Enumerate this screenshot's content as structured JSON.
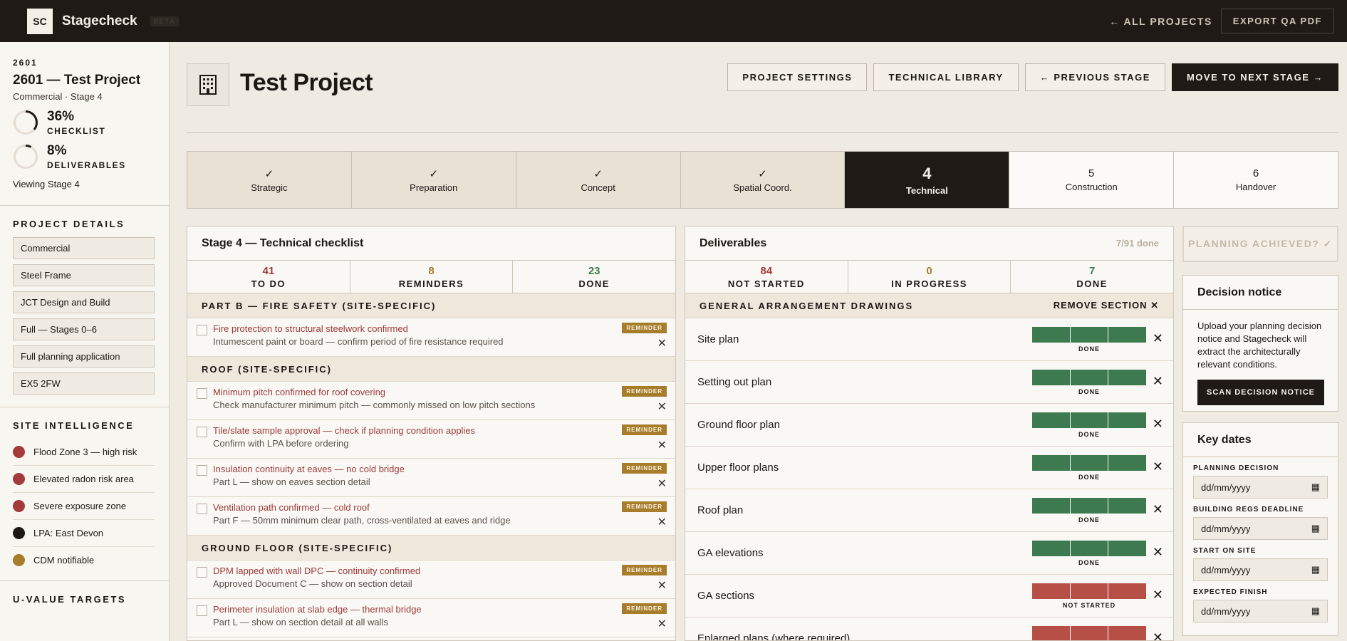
{
  "app": {
    "logo": "SC",
    "brand": "Stagecheck",
    "beta": "BETA"
  },
  "topbar": {
    "all_projects": "← ALL PROJECTS",
    "export": "EXPORT QA PDF"
  },
  "sidebar": {
    "code": "2601",
    "title": "2601 — Test Project",
    "subtitle": "Commercial · Stage 4",
    "checklist_pct": "36%",
    "checklist_label": "CHECKLIST",
    "checklist_progress": 0.36,
    "deliverables_pct": "8%",
    "deliverables_label": "DELIVERABLES",
    "deliverables_progress": 0.08,
    "viewing": "Viewing Stage 4",
    "details_head": "PROJECT DETAILS",
    "details": [
      "Commercial",
      "Steel Frame",
      "JCT Design and Build",
      "Full — Stages 0–6",
      "Full planning application",
      "EX5 2FW"
    ],
    "site_head": "SITE INTELLIGENCE",
    "site": [
      {
        "label": "Flood Zone 3 — high risk",
        "color": "#a33b3b"
      },
      {
        "label": "Elevated radon risk area",
        "color": "#a33b3b"
      },
      {
        "label": "Severe exposure zone",
        "color": "#a33b3b"
      },
      {
        "label": "LPA: East Devon",
        "color": "#1c1814"
      },
      {
        "label": "CDM notifiable",
        "color": "#a77d2c"
      }
    ],
    "uvalue_head": "U-VALUE TARGETS"
  },
  "header": {
    "title": "Test Project",
    "buttons": {
      "settings": "PROJECT SETTINGS",
      "library": "TECHNICAL LIBRARY",
      "prev": "← PREVIOUS STAGE",
      "next": "MOVE TO NEXT STAGE →"
    }
  },
  "stages": [
    {
      "mark": "✓",
      "label": "Strategic",
      "state": "done"
    },
    {
      "mark": "✓",
      "label": "Preparation",
      "state": "done"
    },
    {
      "mark": "✓",
      "label": "Concept",
      "state": "done"
    },
    {
      "mark": "✓",
      "label": "Spatial Coord.",
      "state": "done"
    },
    {
      "mark": "4",
      "label": "Technical",
      "state": "active"
    },
    {
      "mark": "5",
      "label": "Construction",
      "state": "future"
    },
    {
      "mark": "6",
      "label": "Handover",
      "state": "future"
    }
  ],
  "checklist": {
    "title": "Stage 4 — Technical checklist",
    "counts": [
      {
        "n": "41",
        "label": "TO DO",
        "color": "#a33b3b"
      },
      {
        "n": "8",
        "label": "REMINDERS",
        "color": "#a77d2c"
      },
      {
        "n": "23",
        "label": "DONE",
        "color": "#3d7a50"
      }
    ],
    "reminder_tag": "REMINDER",
    "sections": [
      {
        "head": "PART B — FIRE SAFETY (SITE-SPECIFIC)",
        "items": [
          {
            "title": "Fire protection to structural steelwork confirmed",
            "desc": "Intumescent paint or board — confirm period of fire resistance required"
          }
        ]
      },
      {
        "head": "ROOF (SITE-SPECIFIC)",
        "items": [
          {
            "title": "Minimum pitch confirmed for roof covering",
            "desc": "Check manufacturer minimum pitch — commonly missed on low pitch sections"
          },
          {
            "title": "Tile/slate sample approval — check if planning condition applies",
            "desc": "Confirm with LPA before ordering"
          },
          {
            "title": "Insulation continuity at eaves — no cold bridge",
            "desc": "Part L — show on eaves section detail"
          },
          {
            "title": "Ventilation path confirmed — cold roof",
            "desc": "Part F — 50mm minimum clear path, cross-ventilated at eaves and ridge"
          }
        ]
      },
      {
        "head": "GROUND FLOOR (SITE-SPECIFIC)",
        "items": [
          {
            "title": "DPM lapped with wall DPC — continuity confirmed",
            "desc": "Approved Document C — show on section detail"
          },
          {
            "title": "Perimeter insulation at slab edge — thermal bridge",
            "desc": "Part L — show on section detail at all walls"
          }
        ]
      }
    ]
  },
  "deliverables": {
    "title": "Deliverables",
    "done": "7/91 done",
    "counts": [
      {
        "n": "84",
        "label": "NOT STARTED",
        "color": "#a33b3b"
      },
      {
        "n": "0",
        "label": "IN PROGRESS",
        "color": "#a77d2c"
      },
      {
        "n": "7",
        "label": "DONE",
        "color": "#3d7a50"
      }
    ],
    "section": "GENERAL ARRANGEMENT DRAWINGS",
    "remove": "REMOVE SECTION ✕",
    "items": [
      {
        "name": "Site plan",
        "status": "DONE",
        "color": "#3d7a50"
      },
      {
        "name": "Setting out plan",
        "status": "DONE",
        "color": "#3d7a50"
      },
      {
        "name": "Ground floor plan",
        "status": "DONE",
        "color": "#3d7a50"
      },
      {
        "name": "Upper floor plans",
        "status": "DONE",
        "color": "#3d7a50"
      },
      {
        "name": "Roof plan",
        "status": "DONE",
        "color": "#3d7a50"
      },
      {
        "name": "GA elevations",
        "status": "DONE",
        "color": "#3d7a50"
      },
      {
        "name": "GA sections",
        "status": "NOT STARTED",
        "color": "#b65047"
      },
      {
        "name": "Enlarged plans (where required)",
        "status": "",
        "color": "#b65047"
      }
    ]
  },
  "planning": {
    "label": "PLANNING ACHIEVED? ✓"
  },
  "decision": {
    "title": "Decision notice",
    "body": "Upload your planning decision notice and Stagecheck will extract the architecturally relevant conditions.",
    "button": "SCAN DECISION NOTICE"
  },
  "dates": {
    "title": "Key dates",
    "fields": [
      {
        "label": "PLANNING DECISION",
        "placeholder": "dd/mm/yyyy"
      },
      {
        "label": "BUILDING REGS DEADLINE",
        "placeholder": "dd/mm/yyyy"
      },
      {
        "label": "START ON SITE",
        "placeholder": "dd/mm/yyyy"
      },
      {
        "label": "EXPECTED FINISH",
        "placeholder": "dd/mm/yyyy"
      }
    ]
  }
}
